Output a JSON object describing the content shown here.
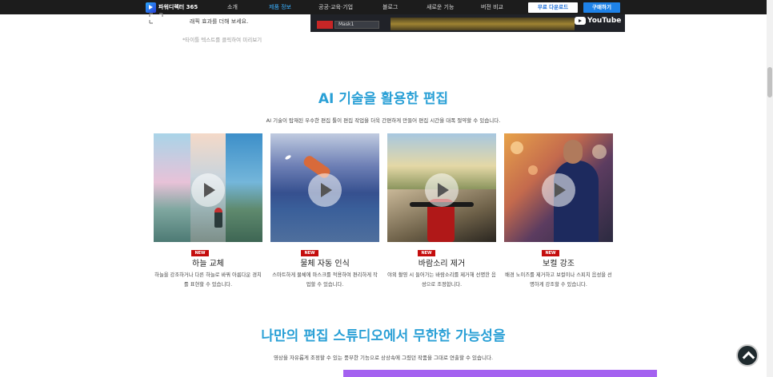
{
  "nav": {
    "logo_text": "파워디렉터 365",
    "items": [
      "소개",
      "제품 정보",
      "공공·교육·기업",
      "블로그",
      "새로운 기능",
      "버전 비교"
    ],
    "active_index": 1,
    "free_download": "무료 다운로드",
    "buy": "구매하기"
  },
  "prev_section": {
    "desc": "래픽 효과를 더해 보세요.",
    "note": "*타이틀 텍스트를 클릭하여 미리보기",
    "video": {
      "mask_label": "Mask1",
      "youtube_label": "YouTube"
    }
  },
  "ai_section": {
    "title": "AI 기술을 활용한 편집",
    "subtitle": "AI 기술이 탑재된 우수한 편집 툴이 편집 작업을 더욱 간편하게 만들어 편집 시간을 대폭 절약할 수 있습니다.",
    "badge": "NEW",
    "cards": [
      {
        "title": "하늘 교체",
        "desc": "하늘을 강조하거나 다른 하늘로 바꿔 아름다운 경치를 표현할 수 있습니다."
      },
      {
        "title": "물체 자동 인식",
        "desc": "스마트하게 물체에 마스크를 적용하여 편리하게 작업할 수 있습니다."
      },
      {
        "title": "바람소리 제거",
        "desc": "야외 촬영 시 들어가는 바람소리를 제거해 선명한 음성으로 조정합니다."
      },
      {
        "title": "보컬 강조",
        "desc": "배경 노이즈를 제거하고 보컬이나 스피치 음성을 선명하게 강조할 수 있습니다."
      }
    ]
  },
  "studio_section": {
    "title": "나만의 편집 스튜디오에서 무한한 가능성을",
    "subtitle": "영상을 자유롭게 조정할 수 있는 풍부한 기능으로 상상속에 그렸던 작품을 그대로 연출할 수 있습니다."
  },
  "colors": {
    "accent": "#2aa0d6",
    "badge": "#c40d0d",
    "nav_bg": "#1c1c1c",
    "buy": "#1e82e8",
    "purple": "#a461f0"
  }
}
